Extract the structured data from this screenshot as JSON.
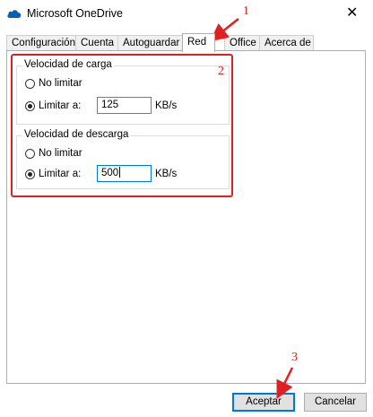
{
  "window": {
    "title": "Microsoft OneDrive"
  },
  "tabs": [
    {
      "label": "Configuración"
    },
    {
      "label": "Cuenta"
    },
    {
      "label": "Autoguardar"
    },
    {
      "label": "Red"
    },
    {
      "label": "Office"
    },
    {
      "label": "Acerca de"
    }
  ],
  "upload": {
    "title": "Velocidad de carga",
    "no_limit_label": "No limitar",
    "limit_label": "Limitar a:",
    "value": "125",
    "unit": "KB/s"
  },
  "download": {
    "title": "Velocidad de descarga",
    "no_limit_label": "No limitar",
    "limit_label": "Limitar a:",
    "value": "500",
    "unit": "KB/s"
  },
  "buttons": {
    "ok": "Aceptar",
    "cancel": "Cancelar"
  },
  "annotations": {
    "n1": "1",
    "n2": "2",
    "n3": "3"
  },
  "colors": {
    "accent": "#0078d7",
    "annotation": "#e02020"
  }
}
